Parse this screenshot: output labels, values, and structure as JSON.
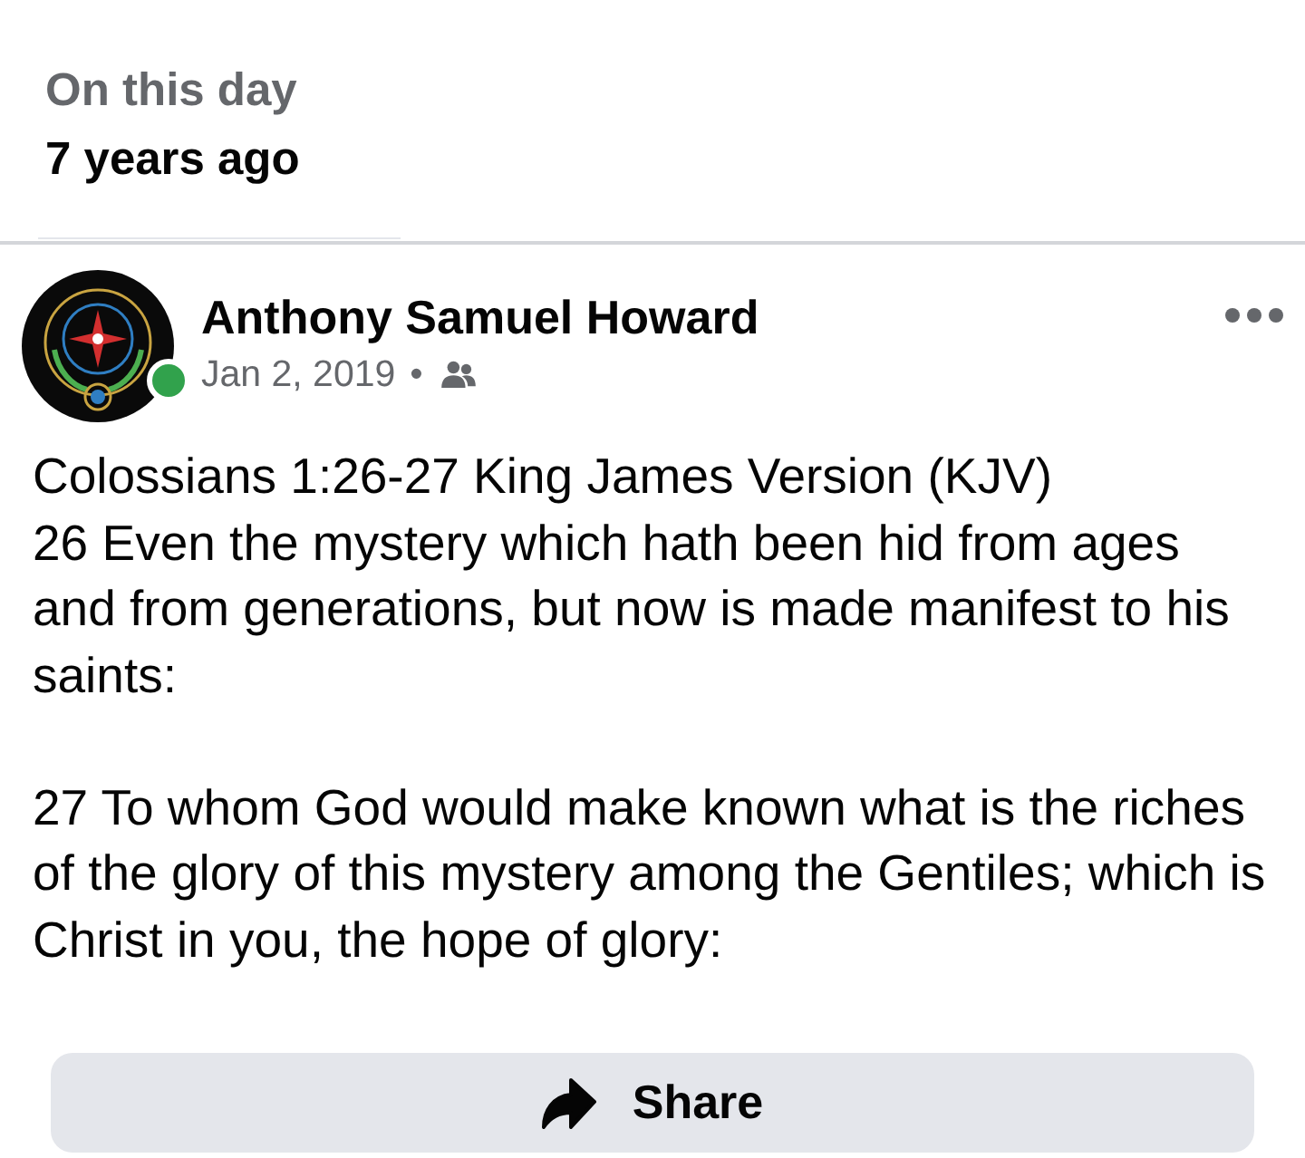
{
  "memory": {
    "subtitle": "On this day",
    "title": "7 years ago"
  },
  "post": {
    "author": "Anthony Samuel Howard",
    "online": true,
    "date": "Jan 2, 2019",
    "separator": "•",
    "paragraphs": [
      "Colossians 1:26-27 King James Version (KJV)\n26 Even the mystery which hath been hid from ages and from generations, but now is made manifest to his saints:",
      "27 To whom God would make known what is the riches of the glory of this mystery among the Gentiles; which is Christ in you, the hope of glory:"
    ]
  },
  "actions": [
    {
      "kind": "share",
      "label": "Share"
    }
  ]
}
